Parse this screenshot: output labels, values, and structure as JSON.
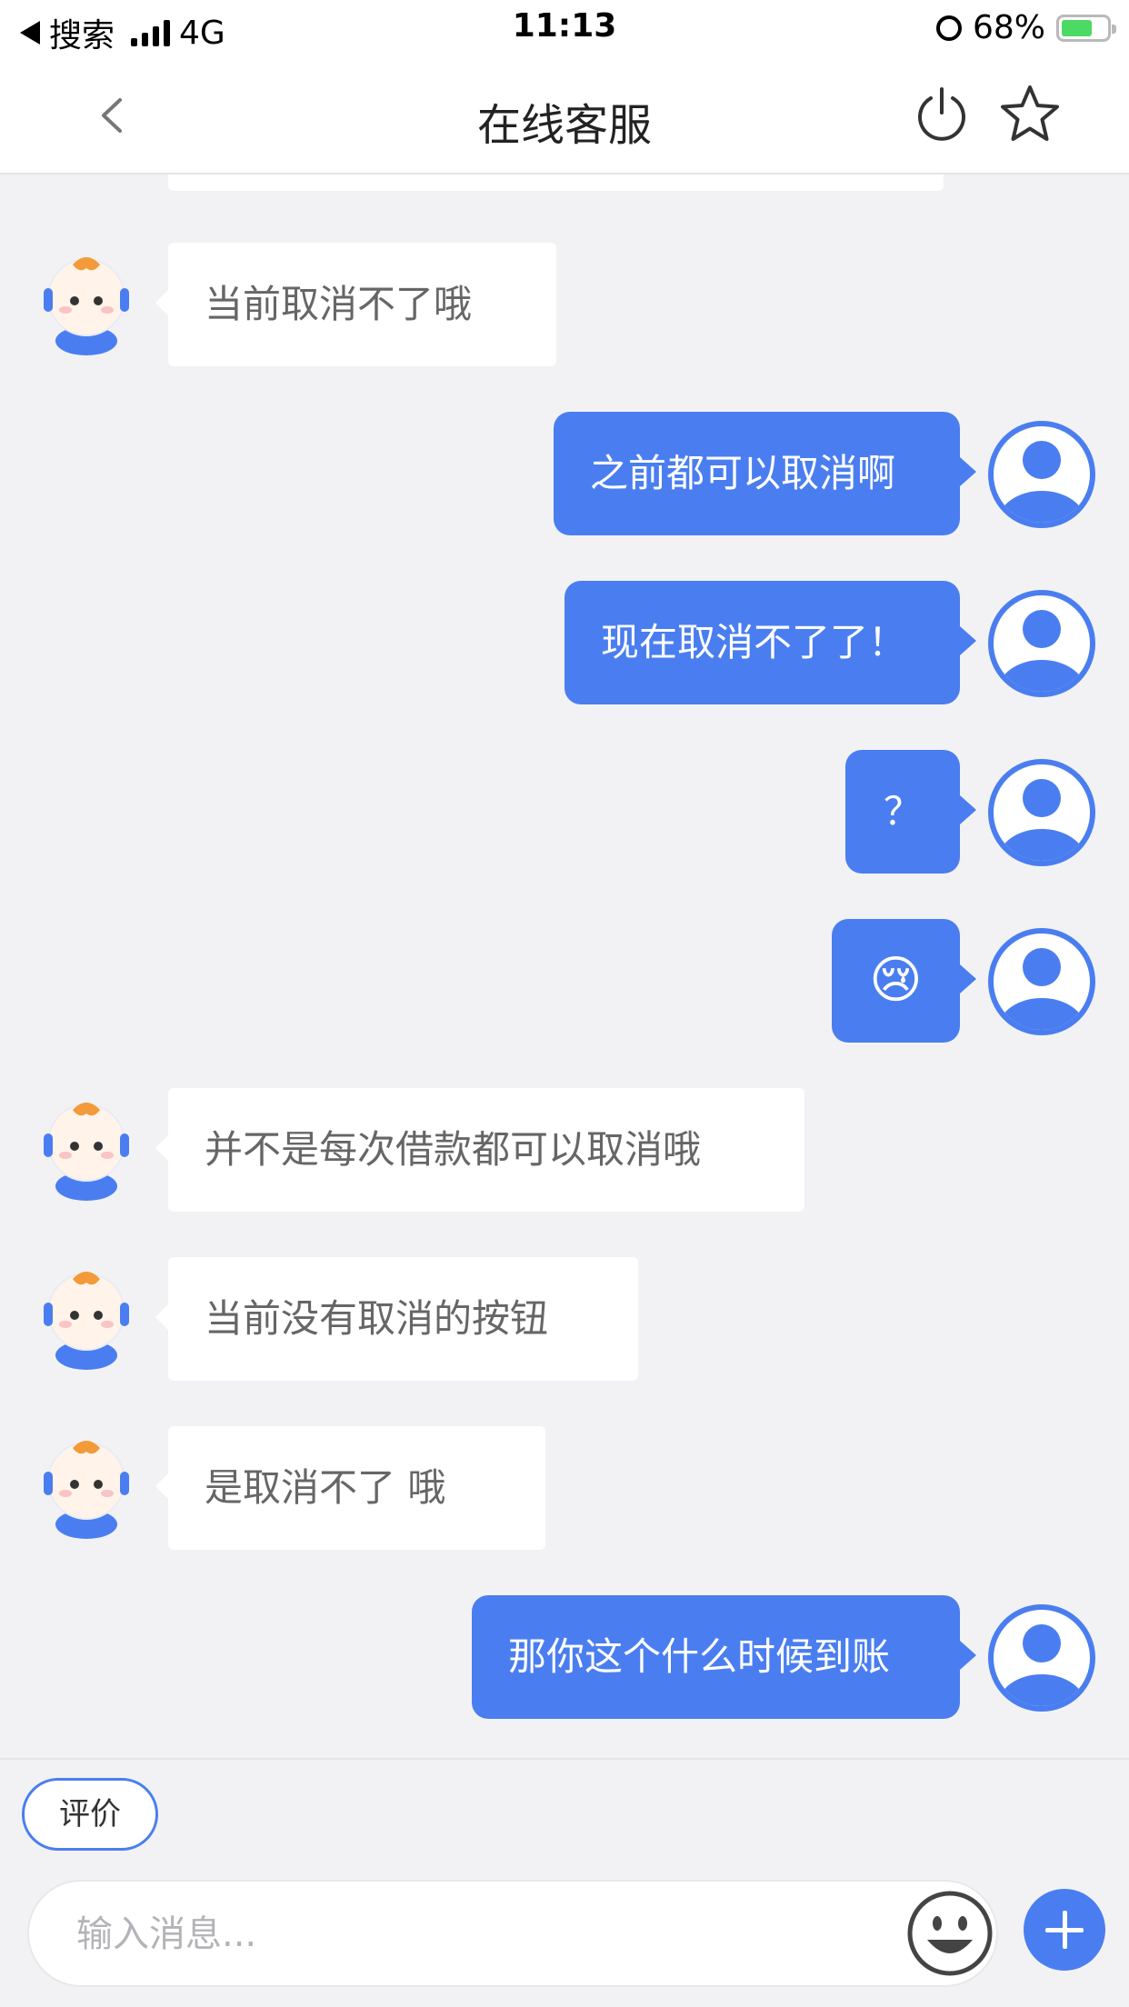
{
  "status_bar": {
    "back_app": "搜索",
    "network": "4G",
    "time": "11:13",
    "battery": "68%"
  },
  "nav": {
    "title": "在线客服",
    "back_icon": "chevron-left-icon",
    "power_icon": "power-icon",
    "star_icon": "star-icon"
  },
  "messages": [
    {
      "from": "agent",
      "text": "当前取消不了哦"
    },
    {
      "from": "user",
      "text": "之前都可以取消啊"
    },
    {
      "from": "user",
      "text": "现在取消不了了！"
    },
    {
      "from": "user",
      "text": "？"
    },
    {
      "from": "user",
      "text": "😢"
    },
    {
      "from": "agent",
      "text": "并不是每次借款都可以取消哦"
    },
    {
      "from": "agent",
      "text": "当前没有取消的按钮"
    },
    {
      "from": "agent",
      "text": "是取消不了 哦"
    },
    {
      "from": "user",
      "text": "那你这个什么时候到账"
    }
  ],
  "bottom": {
    "rate_label": "评价",
    "input_value": "",
    "input_placeholder": "输入消息...",
    "emoji_icon": "smiley-icon",
    "plus_icon": "plus-icon"
  },
  "colors": {
    "accent": "#4a7ef0",
    "background": "#f2f2f4",
    "agent_bubble": "#ffffff",
    "battery_green": "#4cd964"
  }
}
